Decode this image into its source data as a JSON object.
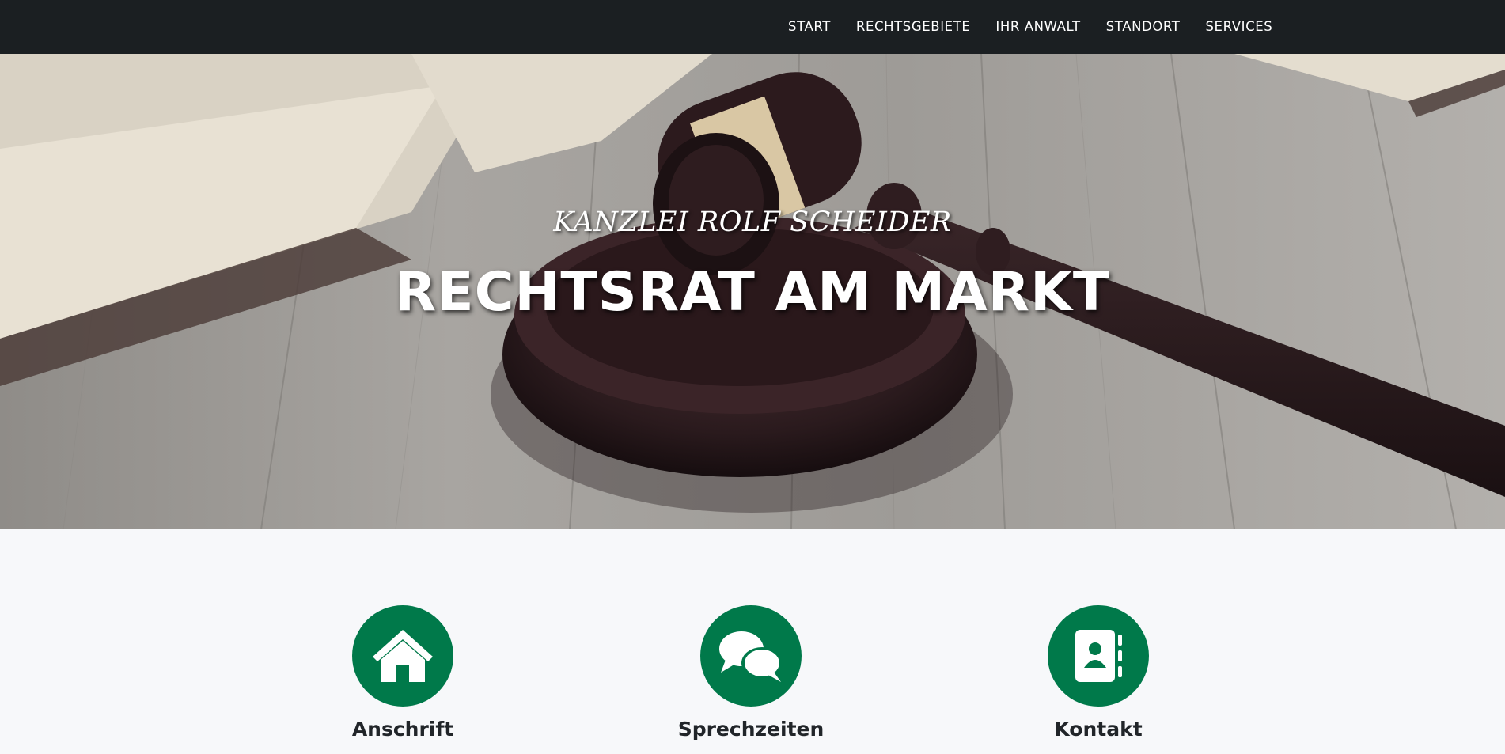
{
  "nav": {
    "items": [
      {
        "label": "START"
      },
      {
        "label": "RECHTSGEBIETE"
      },
      {
        "label": "IHR ANWALT"
      },
      {
        "label": "STANDORT"
      },
      {
        "label": "SERVICES"
      }
    ]
  },
  "hero": {
    "subtitle": "KANZLEI ROLF SCHEIDER",
    "title": "RECHTSRAT AM MARKT"
  },
  "features": [
    {
      "label": "Anschrift",
      "icon": "home-icon"
    },
    {
      "label": "Sprechzeiten",
      "icon": "comments-icon"
    },
    {
      "label": "Kontakt",
      "icon": "address-book-icon"
    }
  ],
  "colors": {
    "navbar_bg": "#1b1f22",
    "accent_green": "#00794a",
    "section_bg": "#f7f8fa",
    "heading_text": "#212529"
  }
}
